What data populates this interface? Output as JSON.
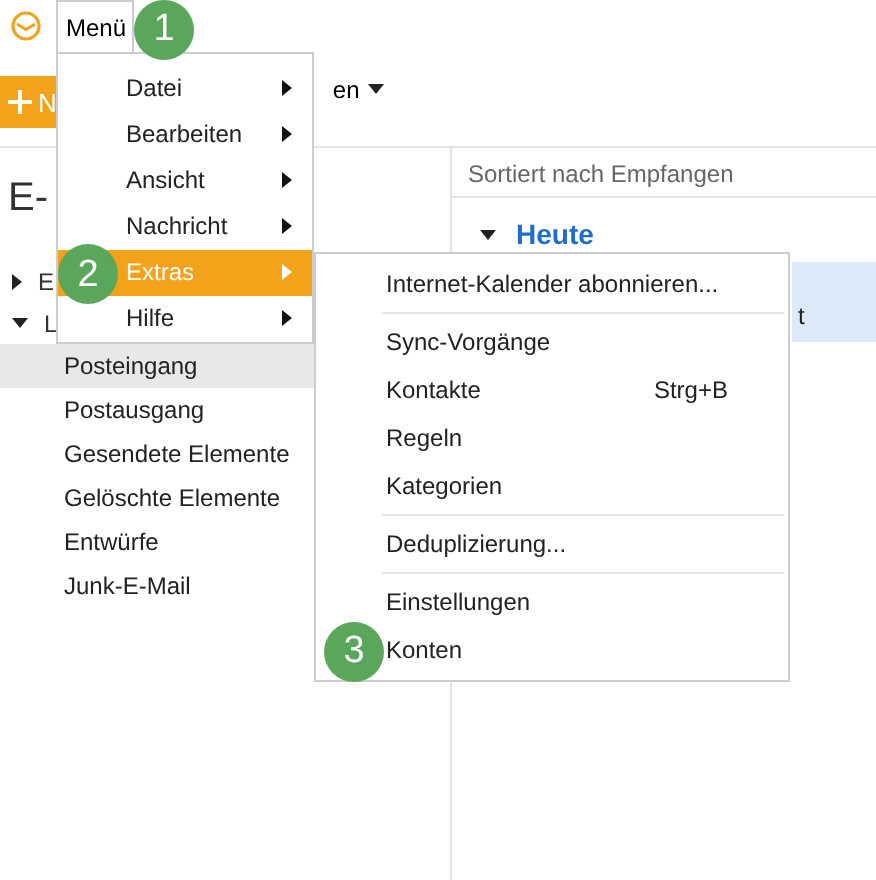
{
  "app_bar": {
    "menu_label": "Menü",
    "callout": "1"
  },
  "toolbar": {
    "new_label": "N",
    "view_label": "en"
  },
  "folder_pane": {
    "title": "E-",
    "tree": [
      {
        "label": "E",
        "expanded": false
      },
      {
        "label": "L",
        "expanded": true,
        "children": [
          {
            "label": "Posteingang",
            "selected": true
          },
          {
            "label": "Postausgang",
            "selected": false
          },
          {
            "label": "Gesendete Elemente",
            "selected": false
          },
          {
            "label": "Gelöschte Elemente",
            "selected": false
          },
          {
            "label": "Entwürfe",
            "selected": false
          },
          {
            "label": "Junk-E-Mail",
            "selected": false
          }
        ]
      }
    ]
  },
  "message_list": {
    "sort_label": "Sortiert nach Empfangen",
    "groups": [
      {
        "label": "Heute",
        "expanded": true,
        "messages": [
          {
            "text": "t",
            "selected": true
          }
        ]
      }
    ]
  },
  "menu": {
    "items": [
      {
        "label": "Datei",
        "selected": false
      },
      {
        "label": "Bearbeiten",
        "selected": false
      },
      {
        "label": "Ansicht",
        "selected": false
      },
      {
        "label": "Nachricht",
        "selected": false
      },
      {
        "label": "Extras",
        "selected": true,
        "callout": "2"
      },
      {
        "label": "Hilfe",
        "selected": false
      }
    ]
  },
  "submenu": {
    "items": [
      {
        "kind": "item",
        "label": "Internet-Kalender abonnieren..."
      },
      {
        "kind": "separator"
      },
      {
        "kind": "item",
        "label": "Sync-Vorgänge"
      },
      {
        "kind": "item",
        "label": "Kontakte",
        "shortcut": "Strg+B"
      },
      {
        "kind": "item",
        "label": "Regeln"
      },
      {
        "kind": "item",
        "label": "Kategorien"
      },
      {
        "kind": "separator"
      },
      {
        "kind": "item",
        "label": "Deduplizierung..."
      },
      {
        "kind": "separator"
      },
      {
        "kind": "item",
        "label": "Einstellungen"
      },
      {
        "kind": "item",
        "label": "Konten",
        "callout": "3"
      }
    ]
  }
}
